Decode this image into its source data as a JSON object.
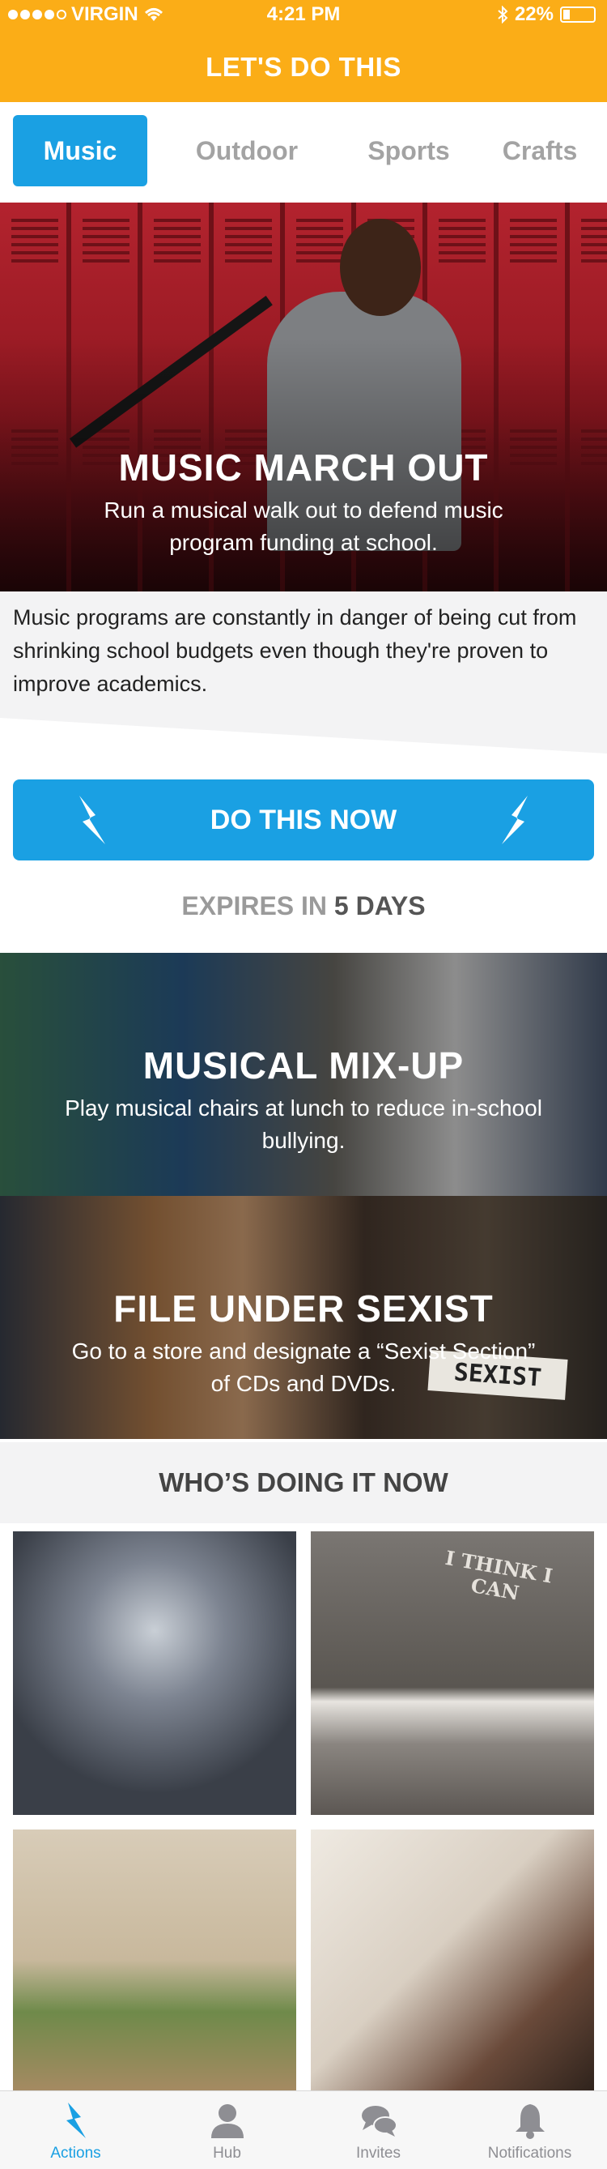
{
  "status_bar": {
    "carrier": "VIRGIN",
    "time": "4:21 PM",
    "battery": "22%",
    "battery_fraction": 0.22,
    "icons": [
      "signal-dots-icon",
      "wifi-icon",
      "bluetooth-icon",
      "battery-icon"
    ]
  },
  "app_bar": {
    "title": "LET'S DO THIS"
  },
  "category_tabs": [
    {
      "label": "Music",
      "active": true
    },
    {
      "label": "Outdoor",
      "active": false
    },
    {
      "label": "Sports",
      "active": false
    },
    {
      "label": "Crafts",
      "active": false
    }
  ],
  "hero": {
    "title": "MUSIC MARCH OUT",
    "subtitle": "Run a musical walk out to defend music program funding at school."
  },
  "description": "Music programs are constantly in danger of being cut from shrinking school budgets even though they're proven to improve academics.",
  "cta": {
    "label": "DO THIS NOW",
    "icon": "lightning-bolt-icon"
  },
  "expires": {
    "prefix": "EXPIRES IN",
    "value": "5 DAYS"
  },
  "related_actions": [
    {
      "title": "MUSICAL MIX-UP",
      "subtitle": "Play musical chairs at lunch to reduce in-school bullying."
    },
    {
      "title": "FILE UNDER SEXIST",
      "subtitle": "Go to a store and designate a “Sexist Section” of CDs and DVDs.",
      "photo_sign_text": "SEXIST"
    }
  ],
  "whos_doing": {
    "heading": "WHO’S DOING IT NOW",
    "photos": [
      {
        "desc": "can-collection-dress"
      },
      {
        "desc": "cans-spelling",
        "photo_text": "I THINK I CAN"
      },
      {
        "desc": "garden-planting"
      },
      {
        "desc": "dog-selfie"
      }
    ]
  },
  "bottom_tabs": [
    {
      "label": "Actions",
      "icon": "lightning-bolt-icon",
      "active": true
    },
    {
      "label": "Hub",
      "icon": "person-icon",
      "active": false
    },
    {
      "label": "Invites",
      "icon": "chat-bubbles-icon",
      "active": false
    },
    {
      "label": "Notifications",
      "icon": "bell-icon",
      "active": false
    }
  ],
  "colors": {
    "brand_orange": "#fbad17",
    "accent_blue": "#1aa0e3",
    "muted_gray": "#a3a3a3"
  }
}
